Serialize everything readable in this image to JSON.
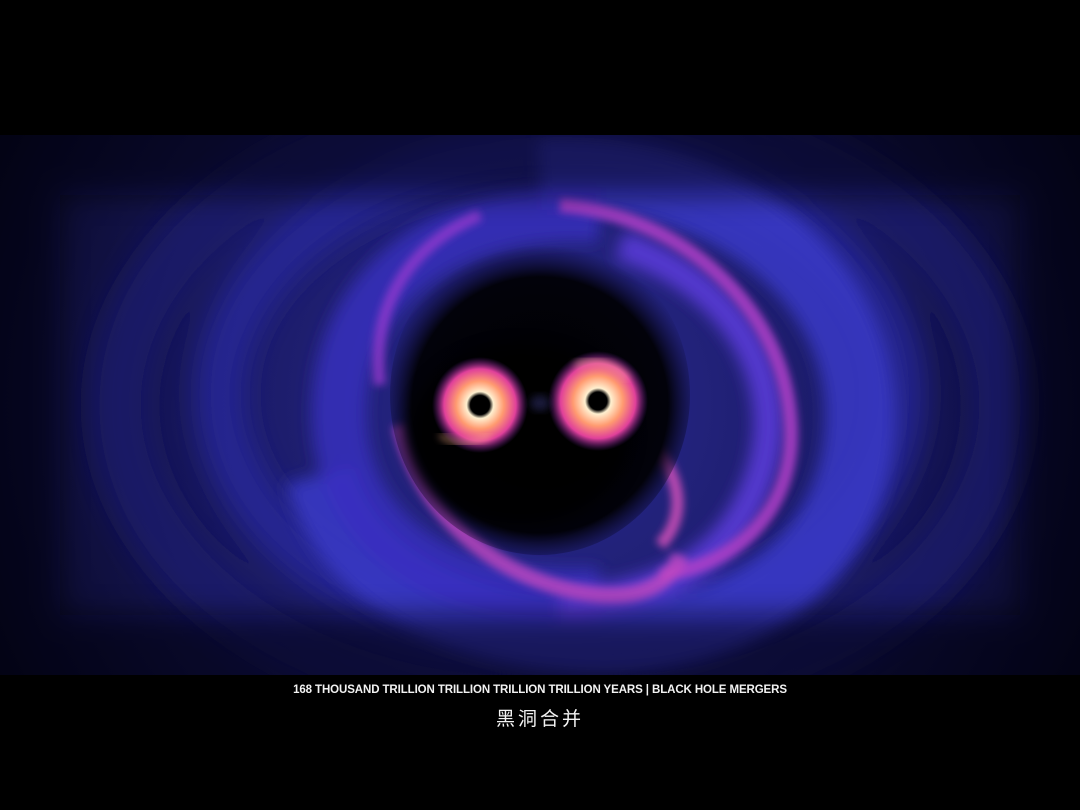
{
  "caption": {
    "line_en": "168  THOUSAND TRILLION TRILLION TRILLION TRILLION YEARS  |  BLACK HOLE MERGERS",
    "line_zh": "黑洞合并"
  },
  "colors": {
    "background": "#000000",
    "outer_gas": "#2a2a9a",
    "mid_gas": "#4a3ad0",
    "hot_gas": "#c040c0",
    "disk_core": "#ffd0a0",
    "caption_text": "#f2f2f2"
  }
}
